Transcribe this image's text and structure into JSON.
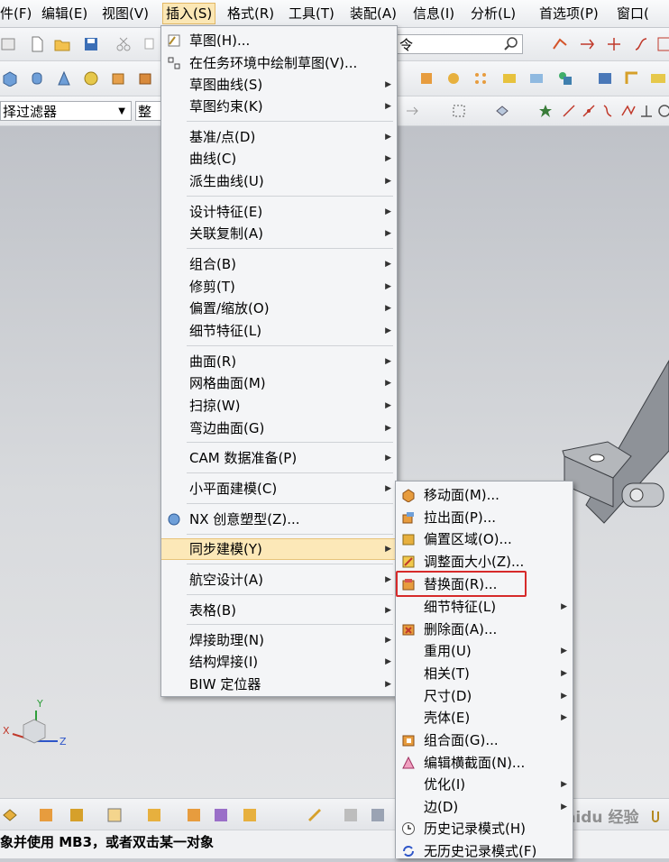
{
  "menubar": {
    "items": [
      "件(F)",
      "编辑(E)",
      "视图(V)",
      "插入(S)",
      "格式(R)",
      "工具(T)",
      "装配(A)",
      "信息(I)",
      "分析(L)",
      "首选项(P)",
      "窗口("
    ]
  },
  "toolbar": {
    "command_search_text": "令",
    "filter_label": "择过滤器",
    "assembly_label": "整"
  },
  "insert_menu": {
    "items": [
      "草图(H)...",
      "在任务环境中绘制草图(V)...",
      "草图曲线(S)",
      "草图约束(K)",
      "基准/点(D)",
      "曲线(C)",
      "派生曲线(U)",
      "设计特征(E)",
      "关联复制(A)",
      "组合(B)",
      "修剪(T)",
      "偏置/缩放(O)",
      "细节特征(L)",
      "曲面(R)",
      "网格曲面(M)",
      "扫掠(W)",
      "弯边曲面(G)",
      "CAM 数据准备(P)",
      "小平面建模(C)",
      "NX 创意塑型(Z)...",
      "同步建模(Y)",
      "航空设计(A)",
      "表格(B)",
      "焊接助理(N)",
      "结构焊接(I)",
      "BIW 定位器"
    ]
  },
  "sync_submenu": {
    "items": [
      "移动面(M)...",
      "拉出面(P)...",
      "偏置区域(O)...",
      "调整面大小(Z)...",
      "替换面(R)...",
      "细节特征(L)",
      "删除面(A)...",
      "重用(U)",
      "相关(T)",
      "尺寸(D)",
      "壳体(E)",
      "组合面(G)...",
      "编辑横截面(N)...",
      "优化(I)",
      "边(D)",
      "历史记录模式(H)",
      "无历史记录模式(F)"
    ]
  },
  "triad": {
    "x": "X",
    "y": "Y",
    "z": "Z"
  },
  "status_text": "象并使用 MB3，或者双击某一对象",
  "watermark": "Baidu 经验",
  "colors": {
    "highlight": "#fce8b8",
    "red_box": "#d62a2a",
    "part": "#8e9298"
  }
}
